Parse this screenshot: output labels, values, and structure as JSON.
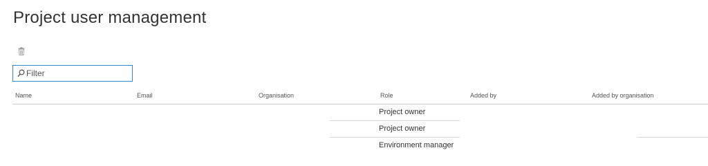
{
  "page": {
    "title": "Project user management"
  },
  "toolbar": {
    "delete_icon": "trash-icon"
  },
  "filter": {
    "placeholder": "Filter",
    "value": "",
    "icon": "search-icon",
    "border_color": "#2e8bd6"
  },
  "grid": {
    "columns": [
      "Name",
      "Email",
      "Organisation",
      "Role",
      "Added by",
      "Added by organisation"
    ],
    "rows": [
      {
        "name": "",
        "email": "",
        "organisation": "",
        "role": "Project owner",
        "added_by": "",
        "added_by_organisation": ""
      },
      {
        "name": "",
        "email": "",
        "organisation": "",
        "role": "Project owner",
        "added_by": "",
        "added_by_organisation": ""
      },
      {
        "name": "",
        "email": "",
        "organisation": "",
        "role": "Environment manager",
        "added_by": "",
        "added_by_organisation": ""
      }
    ]
  }
}
